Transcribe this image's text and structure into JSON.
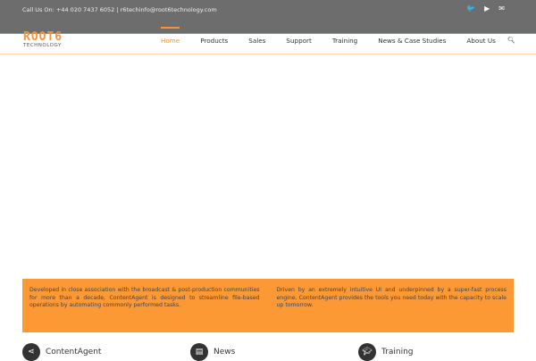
{
  "topbar": {
    "contact": "Call Us On: +44 020 7437 6052 | r6techinfo@root6technology.com",
    "social": [
      "twitter-icon",
      "youtube-icon",
      "envelope-icon"
    ]
  },
  "logo": {
    "line1": "ROOT6",
    "line2": "TECHNOLOGY"
  },
  "nav": [
    "Home",
    "Products",
    "Sales",
    "Support",
    "Training",
    "News & Case Studies",
    "About Us"
  ],
  "banner": {
    "left": "Developed in close association with the broadcast & post-production communities for more than a decade, ContentAgent is designed to streamline file-based operations by automating commonly performed tasks.",
    "right": "Driven by an extremely intuitive UI and underpinned by a super-fast process engine, ContentAgent provides the tools you need today with the capacity to scale up tomorrow."
  },
  "features": [
    "ContentAgent",
    "News",
    "Training"
  ],
  "colors": {
    "accent": "#f7923a",
    "banner": "#fd9934",
    "topbar": "#6d6d6d"
  }
}
